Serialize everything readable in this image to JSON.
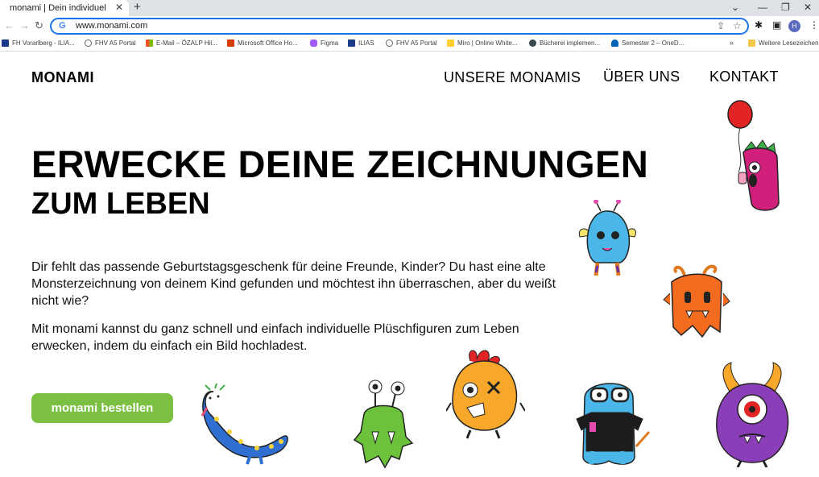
{
  "browser": {
    "tab_title": "monami | Dein individuel",
    "tab_close": "✕",
    "new_tab": "+",
    "url": "www.monami.com",
    "bookmarks": [
      {
        "label": "FH Vorarlberg - ILIA...",
        "icon": "fhv-icon",
        "color": "#1b3a8a"
      },
      {
        "label": "FHV A5 Portal",
        "icon": "globe-icon",
        "color": "#5f6368"
      },
      {
        "label": "E-Mail – ÖZALP Hil...",
        "icon": "microsoft-icon",
        "color": "#f25022"
      },
      {
        "label": "Microsoft Office Ho...",
        "icon": "office-icon",
        "color": "#d83b01"
      },
      {
        "label": "Figma",
        "icon": "figma-icon",
        "color": "#a259ff"
      },
      {
        "label": "ILIAS",
        "icon": "ilias-icon",
        "color": "#1b3a8a"
      },
      {
        "label": "FHV A5 Portal",
        "icon": "globe-icon",
        "color": "#5f6368"
      },
      {
        "label": "Miro | Online White...",
        "icon": "miro-icon",
        "color": "#ffd02f"
      },
      {
        "label": "Bücherei implemen...",
        "icon": "bookmark-icon",
        "color": "#37474f"
      },
      {
        "label": "Semester 2 – OneD...",
        "icon": "onedrive-icon",
        "color": "#0364b8"
      }
    ],
    "more": "»",
    "other_bookmarks": "Weitere Lesezeichen",
    "profile_initial": "H"
  },
  "site": {
    "logo": "MONAMI",
    "nav": [
      "UNSERE MONAMIS",
      "ÜBER UNS",
      "KONTAKT"
    ]
  },
  "hero": {
    "headline_1": "ERWECKE DEINE ZEICHNUNGEN",
    "headline_2": "ZUM LEBEN",
    "paragraph_1": "Dir fehlt das passende Geburtstagsgeschenk für deine Freunde, Kinder? Du hast eine alte Monsterzeichnung von deinem Kind gefunden und möchtest ihn überraschen, aber du weißt nicht wie?",
    "paragraph_2": "Mit monami kannst du ganz schnell und einfach individuelle Plüschfiguren zum Leben erwecken, indem du einfach ein Bild hochladest.",
    "cta": "monami bestellen"
  },
  "colors": {
    "cta": "#7bc043",
    "accent_blue": "#1a73e8"
  }
}
